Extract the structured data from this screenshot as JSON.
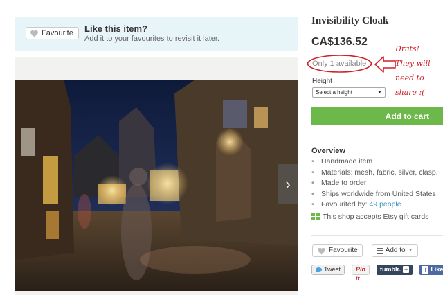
{
  "favourite_banner": {
    "button_label": "Favourite",
    "title": "Like this item?",
    "subtitle": "Add it to your favourites to revisit it later."
  },
  "listing": {
    "title": "Invisibility Cloak",
    "price": "CA$136.52",
    "availability": "Only 1 available",
    "height_label": "Height",
    "height_select": "Select a height",
    "add_to_cart": "Add to cart"
  },
  "overview": {
    "heading": "Overview",
    "items": [
      "Handmade item",
      "Materials: mesh, fabric, silver, clasp,",
      "Made to order",
      "Ships worldwide from United States"
    ],
    "favourited_prefix": "Favourited by:",
    "favourited_link": "49 people"
  },
  "gift_text": "This shop accepts Etsy gift cards",
  "actions": {
    "favourite": "Favourite",
    "add_to": "Add to"
  },
  "social": {
    "tweet": "Tweet",
    "pinit": "Pin it",
    "tumblr": "tumblr.",
    "tumblr_plus": "+",
    "like": "Like"
  },
  "annotation": {
    "lines": [
      "Drats!",
      "They will",
      "need to",
      "share :("
    ],
    "color": "#d0202a"
  },
  "icons": {
    "heart": "heart-icon",
    "next": "chevron-right-icon",
    "gift": "gift-card-icon",
    "add_to": "list-icon"
  },
  "colors": {
    "banner_bg": "#e7f4f8",
    "cart_green": "#6cb84a",
    "link_blue": "#3a8fc1"
  }
}
